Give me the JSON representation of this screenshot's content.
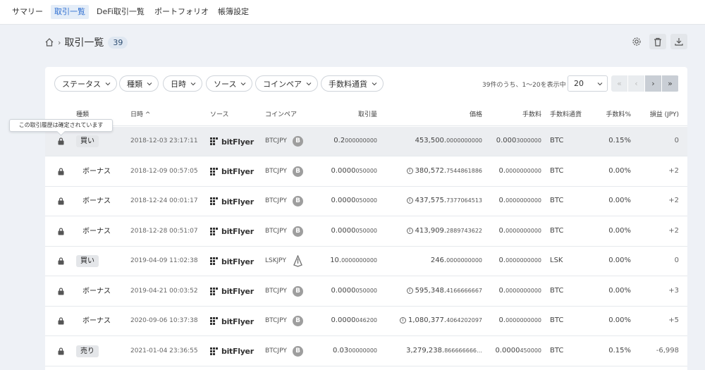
{
  "nav": {
    "tabs": [
      {
        "label": "サマリー",
        "active": false
      },
      {
        "label": "取引一覧",
        "active": true
      },
      {
        "label": "DeFi取引一覧",
        "active": false
      },
      {
        "label": "ポートフォリオ",
        "active": false
      },
      {
        "label": "帳簿設定",
        "active": false
      }
    ]
  },
  "header": {
    "title": "取引一覧",
    "count": "39",
    "icons": [
      "home-icon",
      "gear-icon",
      "trash-icon",
      "download-icon"
    ]
  },
  "filters": [
    "ステータス",
    "種類",
    "日時",
    "ソース",
    "コインペア",
    "手数料通貨"
  ],
  "pagination": {
    "info": "39件のうち、1〜20を表示中",
    "per_page": "20",
    "buttons": [
      "«",
      "‹",
      "›",
      "»"
    ]
  },
  "columns": {
    "type": "種類",
    "date": "日時 ^",
    "source": "ソース",
    "pair": "コインペア",
    "volume": "取引量",
    "price": "価格",
    "fee": "手数料",
    "fee_currency": "手数料通貨",
    "fee_pct": "手数料%",
    "pnl": "損益 (JPY)"
  },
  "tooltip": "この取引履歴は確定されています",
  "rows": [
    {
      "type": "買い",
      "tag": true,
      "date": "2018-12-03 23:17:11",
      "source": "bitFlyer",
      "pair": "BTCJPY",
      "coin": "B",
      "vol_int": "0.2",
      "vol_dec": "000000000",
      "price_info": false,
      "price_int": "453,500.",
      "price_dec": "0000000000",
      "fee_int": "0.000",
      "fee_dec": "3000000",
      "fee_cur": "BTC",
      "fee_pct": "0.15%",
      "pnl": "0"
    },
    {
      "type": "ボーナス",
      "tag": false,
      "date": "2018-12-09 00:57:05",
      "source": "bitFlyer",
      "pair": "BTCJPY",
      "coin": "B",
      "vol_int": "0.0000",
      "vol_dec": "050000",
      "price_info": true,
      "price_int": "380,572.",
      "price_dec": "7544861886",
      "fee_int": "0.",
      "fee_dec": "0000000000",
      "fee_cur": "BTC",
      "fee_pct": "0.00%",
      "pnl": "+2"
    },
    {
      "type": "ボーナス",
      "tag": false,
      "date": "2018-12-24 00:01:17",
      "source": "bitFlyer",
      "pair": "BTCJPY",
      "coin": "B",
      "vol_int": "0.0000",
      "vol_dec": "050000",
      "price_info": true,
      "price_int": "437,575.",
      "price_dec": "7377064513",
      "fee_int": "0.",
      "fee_dec": "0000000000",
      "fee_cur": "BTC",
      "fee_pct": "0.00%",
      "pnl": "+2"
    },
    {
      "type": "ボーナス",
      "tag": false,
      "date": "2018-12-28 00:51:07",
      "source": "bitFlyer",
      "pair": "BTCJPY",
      "coin": "B",
      "vol_int": "0.0000",
      "vol_dec": "050000",
      "price_info": true,
      "price_int": "413,909.",
      "price_dec": "2889743622",
      "fee_int": "0.",
      "fee_dec": "0000000000",
      "fee_cur": "BTC",
      "fee_pct": "0.00%",
      "pnl": "+2"
    },
    {
      "type": "買い",
      "tag": true,
      "date": "2019-04-09 11:02:38",
      "source": "bitFlyer",
      "pair": "LSKJPY",
      "coin": "LSK",
      "vol_int": "10.",
      "vol_dec": "0000000000",
      "price_info": false,
      "price_int": "246.",
      "price_dec": "0000000000",
      "fee_int": "0.",
      "fee_dec": "0000000000",
      "fee_cur": "LSK",
      "fee_pct": "0.00%",
      "pnl": "0"
    },
    {
      "type": "ボーナス",
      "tag": false,
      "date": "2019-04-21 00:03:52",
      "source": "bitFlyer",
      "pair": "BTCJPY",
      "coin": "B",
      "vol_int": "0.0000",
      "vol_dec": "050000",
      "price_info": true,
      "price_int": "595,348.",
      "price_dec": "4166666667",
      "fee_int": "0.",
      "fee_dec": "0000000000",
      "fee_cur": "BTC",
      "fee_pct": "0.00%",
      "pnl": "+3"
    },
    {
      "type": "ボーナス",
      "tag": false,
      "date": "2020-09-06 10:37:38",
      "source": "bitFlyer",
      "pair": "BTCJPY",
      "coin": "B",
      "vol_int": "0.0000",
      "vol_dec": "046200",
      "price_info": true,
      "price_int": "1,080,377.",
      "price_dec": "4064202097",
      "fee_int": "0.",
      "fee_dec": "0000000000",
      "fee_cur": "BTC",
      "fee_pct": "0.00%",
      "pnl": "+5"
    },
    {
      "type": "売り",
      "tag": true,
      "date": "2021-01-04 23:36:55",
      "source": "bitFlyer",
      "pair": "BTCJPY",
      "coin": "B",
      "vol_int": "0.03",
      "vol_dec": "00000000",
      "price_info": false,
      "price_int": "3,279,238.",
      "price_dec": "866666666…",
      "fee_int": "0.0000",
      "fee_dec": "450000",
      "fee_cur": "BTC",
      "fee_pct": "0.15%",
      "pnl": "-6,998"
    }
  ],
  "colors": {
    "accent": "#2f6fd1",
    "active_tab_bg": "#e4edf8",
    "page_bg": "#eef1f6"
  }
}
